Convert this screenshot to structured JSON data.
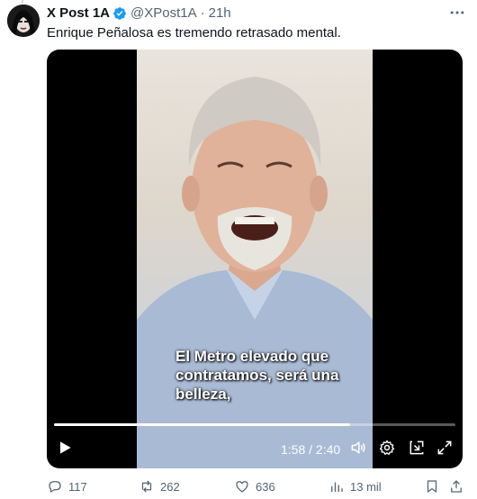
{
  "post": {
    "display_name": "X Post 1A",
    "handle": "@XPost1A",
    "separator": "·",
    "time": "21h",
    "text": "Enrique Peñalosa es tremendo retrasado mental."
  },
  "video": {
    "subtitle_lines": [
      "El Metro elevado que",
      "contratamos, será una",
      "belleza,"
    ],
    "current_time": "1:58",
    "duration": "2:40",
    "timecode": "1:58 / 2:40",
    "progress_fraction": 0.7375
  },
  "actions": {
    "replies": "117",
    "reposts": "262",
    "likes": "636",
    "views": "13 mil"
  },
  "colors": {
    "verified": "#1d9bf0",
    "muted_text": "#536471",
    "text": "#0f1419"
  },
  "icons": {
    "verified": "verified-badge-icon",
    "more": "more-dots-icon",
    "play": "play-icon",
    "volume": "volume-icon",
    "settings": "gear-icon",
    "pip": "picture-in-picture-icon",
    "fullscreen": "fullscreen-icon",
    "reply": "reply-icon",
    "repost": "repost-icon",
    "like": "heart-icon",
    "views": "views-bar-chart-icon",
    "bookmark": "bookmark-icon",
    "share": "share-icon"
  }
}
